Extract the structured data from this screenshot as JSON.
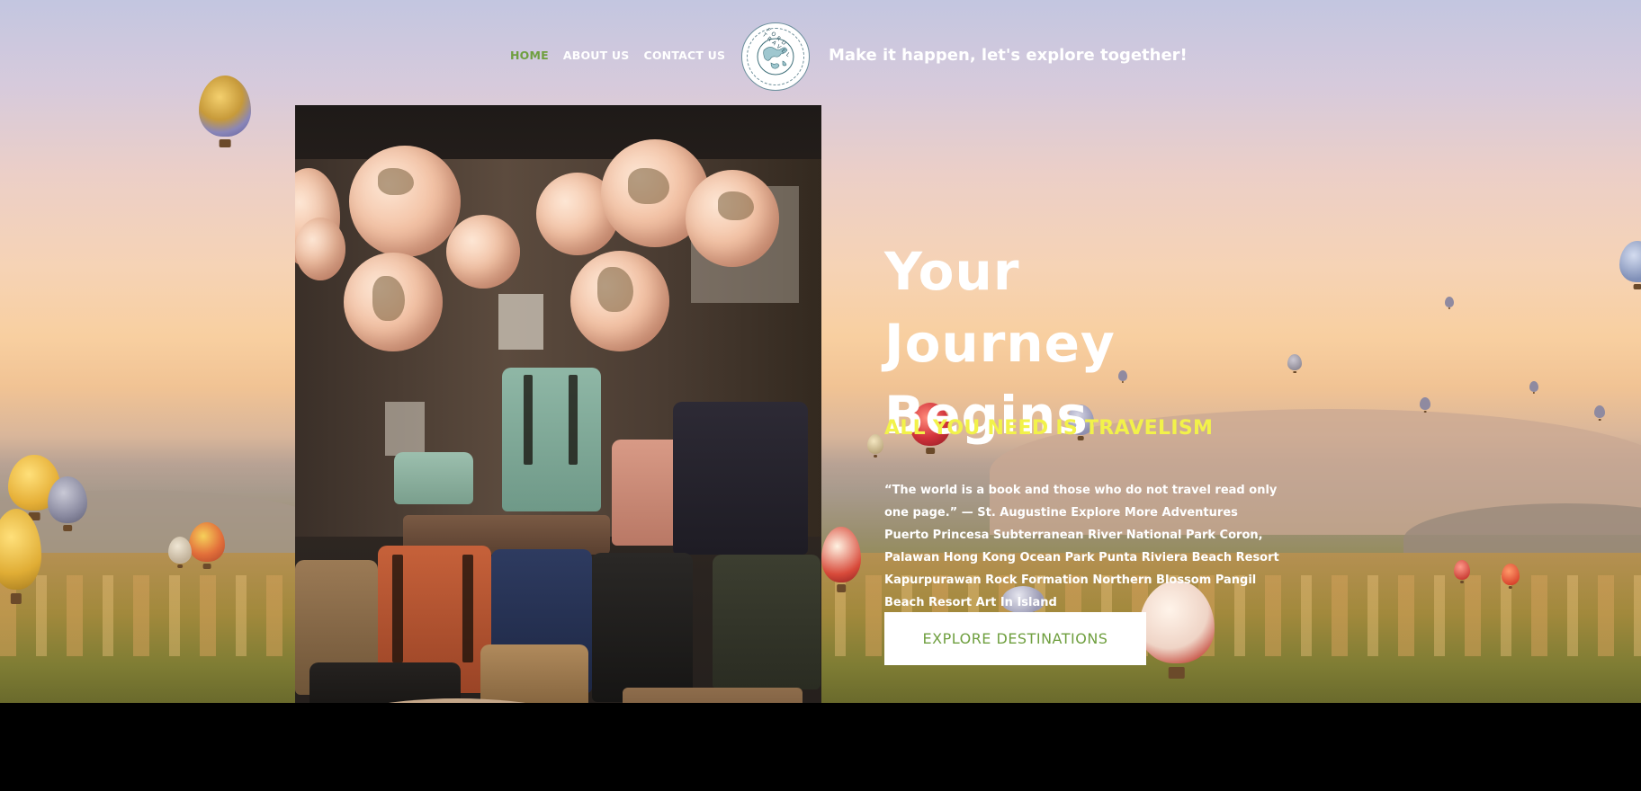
{
  "nav": {
    "items": [
      {
        "label": "HOME",
        "active": true
      },
      {
        "label": "ABOUT US",
        "active": false
      },
      {
        "label": "CONTACT US",
        "active": false
      }
    ],
    "active_color": "#6f9f3f"
  },
  "logo": {
    "icon": "globe-map-logo-icon",
    "ring_text": "FORD TRAVEL"
  },
  "tagline": "Make it happen, let's explore together!",
  "hero": {
    "title_line1": "Your Journey",
    "title_line2": "Begins",
    "subtitle": "ALL YOU NEED IS TRAVELISM",
    "body": "“The world is a book and those who do not travel read only one page.” — St. Augustine Explore More Adventures Puerto Princesa Subterranean River National Park Coron, Palawan Hong Kong Ocean Park Punta Riviera Beach Resort Kapurpurawan Rock Formation Northern Blossom Pangil Beach Resort Art In Island",
    "cta_label": "EXPLORE DESTINATIONS",
    "subtitle_color": "#f2f24a"
  },
  "photo": {
    "subject": "travel shop with globes and backpacks"
  }
}
